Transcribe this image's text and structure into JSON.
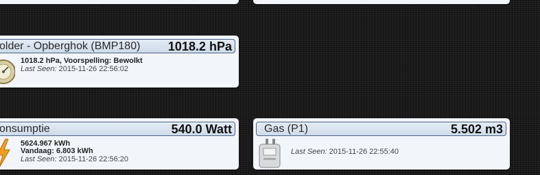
{
  "tiles": {
    "barometer": {
      "name": "older - Opberghok (BMP180)",
      "value": "1018.2 hPa",
      "detail": "1018.2 hPa, Voorspelling: Bewolkt",
      "last_seen_label": "Last Seen:",
      "last_seen": "2015-11-26 22:56:02",
      "icon": "barometer-icon"
    },
    "consumption": {
      "name": "onsumptie",
      "value": "540.0 Watt",
      "detail_1": "5624.967 kWh",
      "detail_2": "Vandaag: 6.803 kWh",
      "last_seen_label": "Last Seen:",
      "last_seen": "2015-11-26 22:56:20",
      "icon": "lightning-icon"
    },
    "gas": {
      "name": "Gas (P1)",
      "value": "5.502 m3",
      "last_seen_label": "Last Seen:",
      "last_seen": "2015-11-26 22:55:40",
      "icon": "gas-meter-icon"
    }
  },
  "colors": {
    "tile_bg": "#f2f5fa",
    "header_border": "#4a6286",
    "page_bg": "#1b1b1b"
  }
}
